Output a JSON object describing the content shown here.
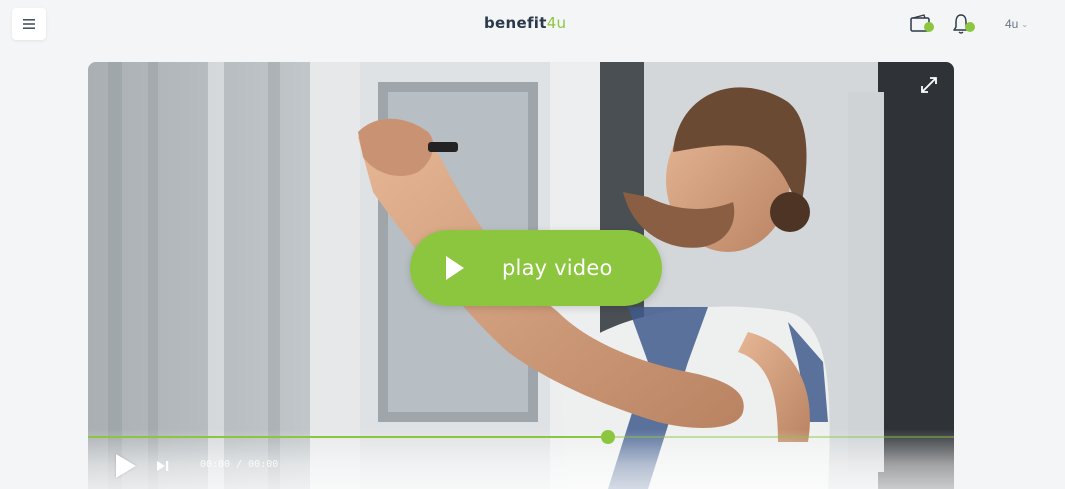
{
  "header": {
    "logo_part1": "benefit",
    "logo_part2": "4u",
    "user_label": "4u",
    "user_chevron": "⌄"
  },
  "icons": {
    "menu": "menu-icon",
    "wallet": "wallet-icon",
    "bell": "bell-icon",
    "expand": "expand-icon",
    "play": "play-icon",
    "next": "skip-next-icon"
  },
  "video": {
    "play_label": "play video",
    "timecode": "00:00 / 00:00",
    "progress": 0.6
  },
  "colors": {
    "accent": "#8cc63f",
    "logo_dark": "#2b3a4a",
    "background": "#f4f5f6"
  }
}
